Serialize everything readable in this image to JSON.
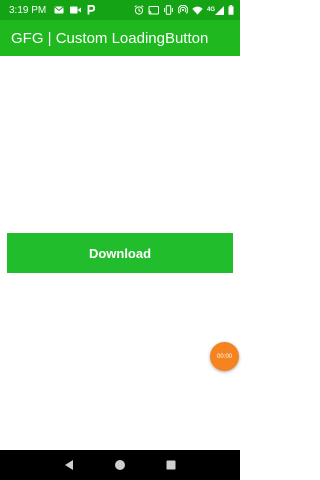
{
  "status_bar": {
    "time": "3:19 PM",
    "network": "4G",
    "left_icons": [
      "mail-icon",
      "video-icon",
      "parking-icon"
    ],
    "right_icons": [
      "alarm-icon",
      "cast-icon",
      "vibrate-icon",
      "hotspot-icon",
      "wifi-icon",
      "signal-icon",
      "battery-icon"
    ]
  },
  "app_bar": {
    "title": "GFG | Custom LoadingButton"
  },
  "main": {
    "download_label": "Download"
  },
  "timer": {
    "text": "00:00"
  },
  "nav_bar": {
    "icons": [
      "back-icon",
      "home-icon",
      "recents-icon"
    ]
  },
  "colors": {
    "status_bar": "#14a314",
    "app_bar": "#1fb81f",
    "button": "#22bd2c",
    "timer": "#f5831f",
    "nav_bar": "#000000"
  }
}
